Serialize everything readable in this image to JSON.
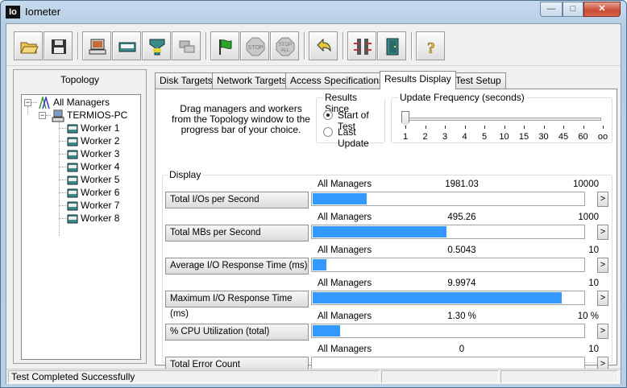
{
  "window": {
    "title": "Iometer",
    "icon_text": "Io"
  },
  "toolbar": {
    "icons": [
      "open-folder-icon",
      "save-icon",
      "display-workers-icon",
      "new-manager-icon",
      "new-disk-worker-icon",
      "new-network-worker-icon",
      "start-tests-icon",
      "stop-icon",
      "stop-all-icon",
      "reset-workers-icon",
      "disconnect-icon",
      "exit-icon",
      "about-icon"
    ],
    "stop_text": "STOP",
    "stop_all_text": "STOP",
    "all_text": "ALL",
    "help_text": "?"
  },
  "topology": {
    "title": "Topology",
    "root": "All Managers",
    "manager": "TERMIOS-PC",
    "workers": [
      "Worker 1",
      "Worker 2",
      "Worker 3",
      "Worker 4",
      "Worker 5",
      "Worker 6",
      "Worker 7",
      "Worker 8"
    ]
  },
  "tabs": [
    {
      "label": "Disk Targets"
    },
    {
      "label": "Network Targets"
    },
    {
      "label": "Access Specifications"
    },
    {
      "label": "Results Display",
      "active": true
    },
    {
      "label": "Test Setup"
    }
  ],
  "results": {
    "drag_hint": "Drag managers and workers from the Topology window to the progress bar of your choice.",
    "results_since": {
      "label": "Results Since",
      "options": [
        "Start of Test",
        "Last Update"
      ],
      "selected": 0
    },
    "update_frequency": {
      "label": "Update Frequency (seconds)",
      "ticks": [
        "1",
        "2",
        "3",
        "4",
        "5",
        "10",
        "15",
        "30",
        "45",
        "60",
        "oo"
      ],
      "selected_index": 0
    },
    "display_label": "Display",
    "rows": [
      {
        "label": "Total I/Os per Second",
        "source": "All Managers",
        "value": "1981.03",
        "max": "10000",
        "fraction": 0.198
      },
      {
        "label": "Total MBs per Second",
        "source": "All Managers",
        "value": "495.26",
        "max": "1000",
        "fraction": 0.495
      },
      {
        "label": "Average I/O Response Time (ms)",
        "source": "All Managers",
        "value": "0.5043",
        "max": "10",
        "fraction": 0.05
      },
      {
        "label": "Maximum I/O Response Time (ms)",
        "source": "All Managers",
        "value": "9.9974",
        "max": "10",
        "fraction": 0.92
      },
      {
        "label": "% CPU Utilization (total)",
        "source": "All Managers",
        "value": "1.30 %",
        "max": "10 %",
        "fraction": 0.1
      },
      {
        "label": "Total Error Count",
        "source": "All Managers",
        "value": "0",
        "max": "10",
        "fraction": 0
      }
    ],
    "arrow_glyph": ">"
  },
  "status": {
    "text": "Test Completed Successfully"
  },
  "colors": {
    "bar_fill": "#3399ff",
    "close_button": "#c94b34"
  }
}
